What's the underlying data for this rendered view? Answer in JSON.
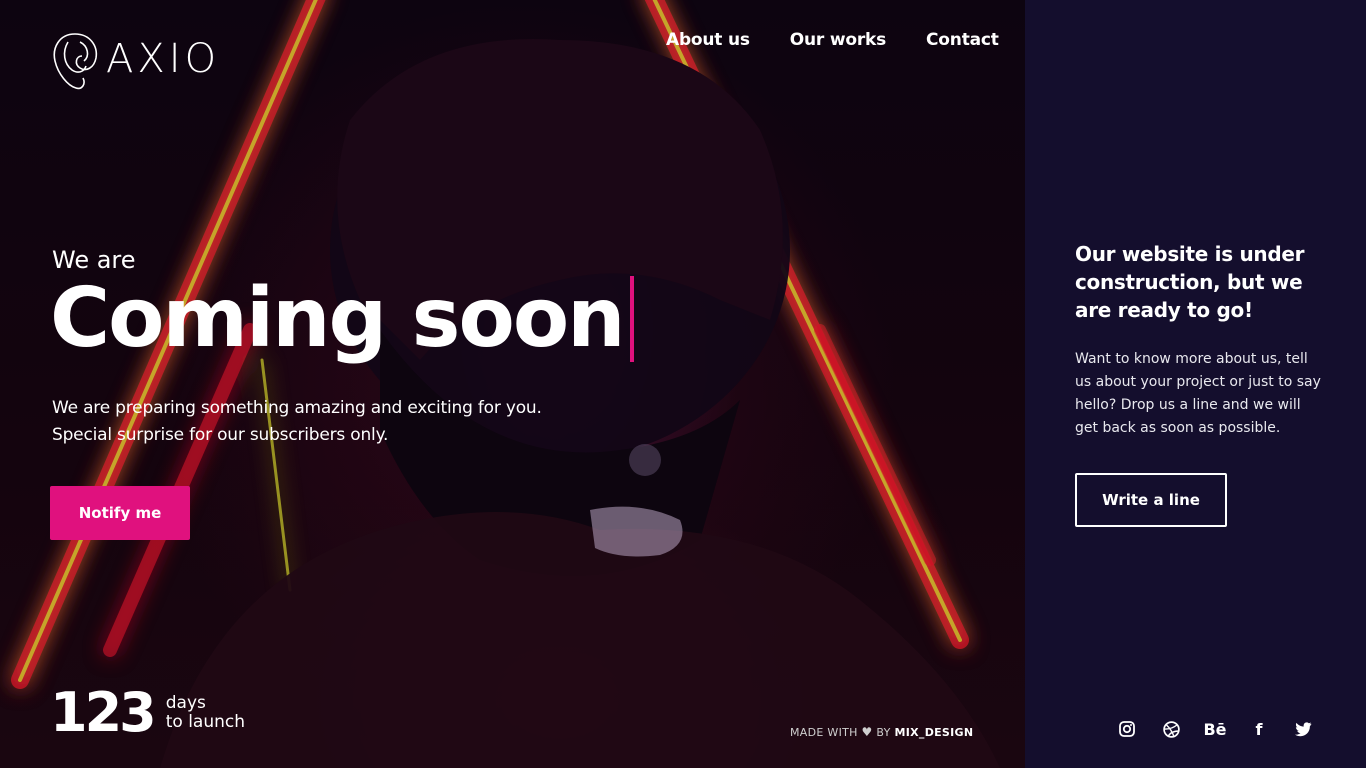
{
  "brand": {
    "name": "AXIO",
    "logo_icon": "swirl-logo-icon"
  },
  "nav": {
    "items": [
      {
        "label": "About us"
      },
      {
        "label": "Our works"
      },
      {
        "label": "Contact"
      }
    ]
  },
  "hero": {
    "kicker": "We are",
    "headline": "Coming soon",
    "sub_line1": "We are preparing something amazing and exciting for you.",
    "sub_line2": "Special surprise for our subscribers only.",
    "notify_label": "Notify me",
    "countdown": {
      "number": "123",
      "unit": "days",
      "caption": "to launch"
    },
    "credit": {
      "prefix": "MADE WITH",
      "by": "BY",
      "author": "MIX_DESIGN"
    }
  },
  "side": {
    "title": "Our website is under construction, but we are ready to go!",
    "text": "Want to know more about us, tell us about your project or just to say hello? Drop us a line and we will get back as soon as possible.",
    "button_label": "Write a line",
    "social": [
      {
        "name": "instagram-icon"
      },
      {
        "name": "dribbble-icon"
      },
      {
        "name": "behance-icon",
        "glyph": "Bē"
      },
      {
        "name": "facebook-icon",
        "glyph": "f"
      },
      {
        "name": "twitter-icon"
      }
    ]
  },
  "colors": {
    "accent": "#e0117e",
    "side_bg": "#140e2d",
    "neon_red": "#e0102a",
    "neon_yellow": "#c8c82a"
  }
}
